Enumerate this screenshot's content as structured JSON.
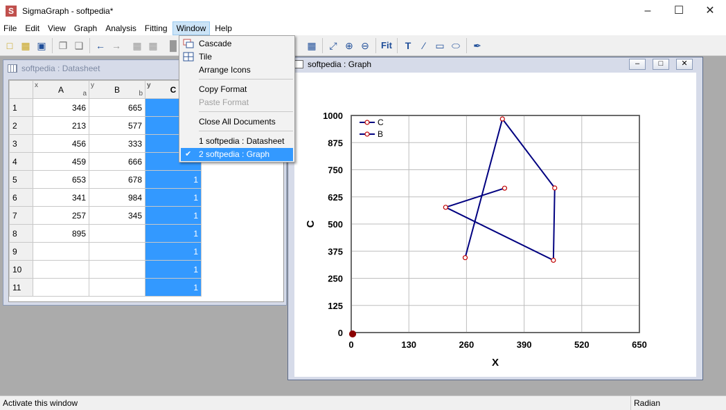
{
  "window": {
    "title": "SigmaGraph - softpedia*",
    "app_icon": "S"
  },
  "menubar": [
    "File",
    "Edit",
    "View",
    "Graph",
    "Analysis",
    "Fitting",
    "Window",
    "Help"
  ],
  "window_menu": {
    "items": [
      {
        "label": "Cascade",
        "icon": "cascade-icon",
        "enabled": true
      },
      {
        "label": "Tile",
        "icon": "tile-icon",
        "enabled": true
      },
      {
        "label": "Arrange Icons",
        "enabled": true
      },
      {
        "label": "Copy Format",
        "enabled": true
      },
      {
        "label": "Paste Format",
        "enabled": false
      },
      {
        "label": "Close All Documents",
        "enabled": true
      },
      {
        "label": "1 softpedia : Datasheet",
        "enabled": true
      },
      {
        "label": "2 softpedia : Graph",
        "enabled": true,
        "checked": true
      }
    ]
  },
  "datasheet": {
    "title": "softpedia : Datasheet",
    "columns": [
      {
        "name": "A",
        "role": "x",
        "sub": "a"
      },
      {
        "name": "B",
        "role": "y",
        "sub": "b"
      },
      {
        "name": "C",
        "role": "y",
        "sub": ""
      }
    ],
    "rows": [
      {
        "n": "1",
        "a": "346",
        "b": "665",
        "c": ""
      },
      {
        "n": "2",
        "a": "213",
        "b": "577",
        "c": ""
      },
      {
        "n": "3",
        "a": "456",
        "b": "333",
        "c": ""
      },
      {
        "n": "4",
        "a": "459",
        "b": "666",
        "c": ""
      },
      {
        "n": "5",
        "a": "653",
        "b": "678",
        "c": "1"
      },
      {
        "n": "6",
        "a": "341",
        "b": "984",
        "c": "1"
      },
      {
        "n": "7",
        "a": "257",
        "b": "345",
        "c": "1"
      },
      {
        "n": "8",
        "a": "895",
        "b": "",
        "c": "1"
      },
      {
        "n": "9",
        "a": "",
        "b": "",
        "c": "1"
      },
      {
        "n": "10",
        "a": "",
        "b": "",
        "c": "1"
      },
      {
        "n": "11",
        "a": "",
        "b": "",
        "c": "1"
      }
    ],
    "selection_color": "#3399ff"
  },
  "graph_window": {
    "title": "softpedia : Graph"
  },
  "chart_data": {
    "type": "line",
    "xlabel": "X",
    "ylabel": "C",
    "xlim": [
      0,
      650
    ],
    "ylim": [
      0,
      1000
    ],
    "xticks": [
      "0",
      "130",
      "260",
      "390",
      "520",
      "650"
    ],
    "yticks": [
      "0",
      "125",
      "250",
      "375",
      "500",
      "625",
      "750",
      "875",
      "1000"
    ],
    "grid": true,
    "legend_position": "top-left",
    "series": [
      {
        "name": "C",
        "color": "#000080",
        "x": [
          0,
          0
        ],
        "y": [
          0,
          0
        ]
      },
      {
        "name": "B",
        "color": "#000080",
        "x": [
          346,
          213,
          456,
          459,
          341,
          257
        ],
        "y": [
          665,
          577,
          333,
          666,
          984,
          345
        ]
      }
    ]
  },
  "statusbar": {
    "text": "Activate this window",
    "mode": "Radian"
  }
}
